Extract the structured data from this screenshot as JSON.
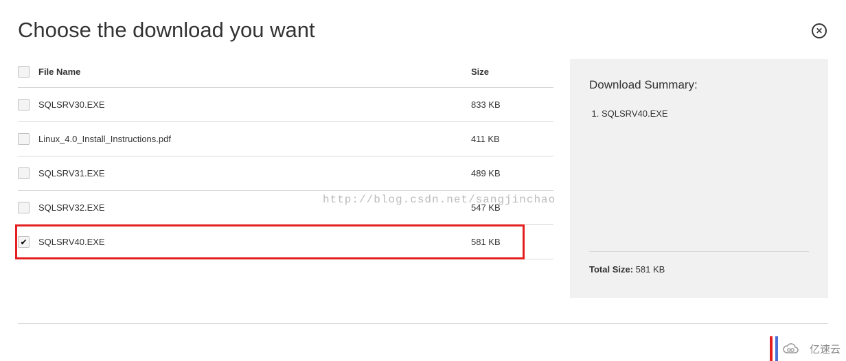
{
  "heading": "Choose the download you want",
  "columns": {
    "name": "File Name",
    "size": "Size"
  },
  "files": [
    {
      "name": "SQLSRV30.EXE",
      "size": "833 KB",
      "checked": false,
      "highlight": false
    },
    {
      "name": "Linux_4.0_Install_Instructions.pdf",
      "size": "411 KB",
      "checked": false,
      "highlight": false
    },
    {
      "name": "SQLSRV31.EXE",
      "size": "489 KB",
      "checked": false,
      "highlight": false
    },
    {
      "name": "SQLSRV32.EXE",
      "size": "547 KB",
      "checked": false,
      "highlight": false
    },
    {
      "name": "SQLSRV40.EXE",
      "size": "581 KB",
      "checked": true,
      "highlight": true
    }
  ],
  "summary": {
    "title": "Download Summary:",
    "items": [
      "SQLSRV40.EXE"
    ],
    "total_label": "Total Size:",
    "total_value": "581 KB"
  },
  "watermark": "http://blog.csdn.net/sangjinchao",
  "brand": "亿速云"
}
